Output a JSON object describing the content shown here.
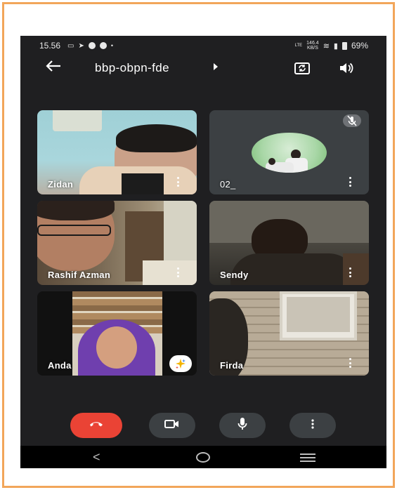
{
  "status_bar": {
    "time": "15.56",
    "network_top": "146.4",
    "network_bottom": "KB/S",
    "lte": "LTE",
    "battery": "69%"
  },
  "app_bar": {
    "meeting_code": "bbp-obpn-fde",
    "icons": [
      "back-arrow-icon",
      "switch-camera-icon",
      "speaker-icon"
    ]
  },
  "participants": [
    {
      "name": "Zidan"
    },
    {
      "name": "02_",
      "muted": true
    },
    {
      "name": "Rashif Azman"
    },
    {
      "name": "Sendy"
    },
    {
      "name": "Anda",
      "effects": true
    },
    {
      "name": "Firda"
    }
  ],
  "controls": {
    "icons": [
      "end-call-icon",
      "camera-icon",
      "microphone-icon",
      "more-options-icon"
    ],
    "end_call_color": "#ea4335"
  },
  "nav_bar": {
    "icons": [
      "nav-back-icon",
      "nav-home-icon",
      "nav-recents-icon"
    ]
  },
  "colors": {
    "background": "#1f1f21",
    "tile": "#3c4043",
    "frame": "#f2a65a"
  }
}
